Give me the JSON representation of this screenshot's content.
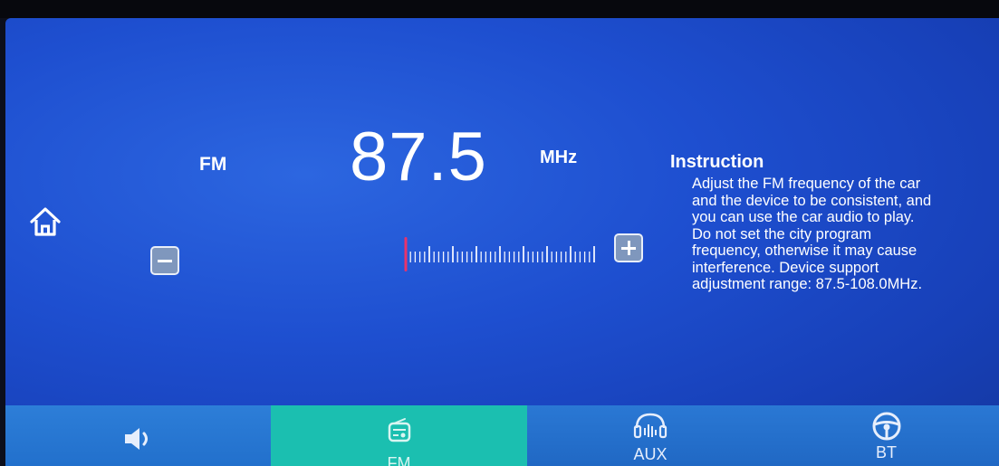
{
  "header": {
    "band": "FM",
    "frequency": "87.5",
    "unit": "MHz"
  },
  "instruction": {
    "title": "Instruction",
    "lines": [
      "Adjust the FM frequency of the car",
      "and the device to be consistent, and",
      "you can use the car audio to play.",
      "Do not set the city program",
      "frequency, otherwise it may cause",
      "interference. Device support",
      "adjustment range: 87.5-108.0MHz."
    ]
  },
  "tuner": {
    "min": 87.5,
    "max": 108.0,
    "current": 87.5,
    "indicator_color": "#e8336b"
  },
  "bottom_nav": {
    "tabs": [
      {
        "name": "volume",
        "label": "",
        "icon": "speaker-icon"
      },
      {
        "name": "fm",
        "label": "FM",
        "icon": "radio-icon",
        "active": true
      },
      {
        "name": "aux",
        "label": "AUX",
        "icon": "aux-speaker-icon"
      },
      {
        "name": "bt",
        "label": "BT",
        "icon": "steering-wheel-icon"
      }
    ],
    "active_color": "#1bbfb0"
  },
  "icons": {
    "home": "home-icon",
    "minus": "minus-icon",
    "plus": "plus-icon"
  }
}
